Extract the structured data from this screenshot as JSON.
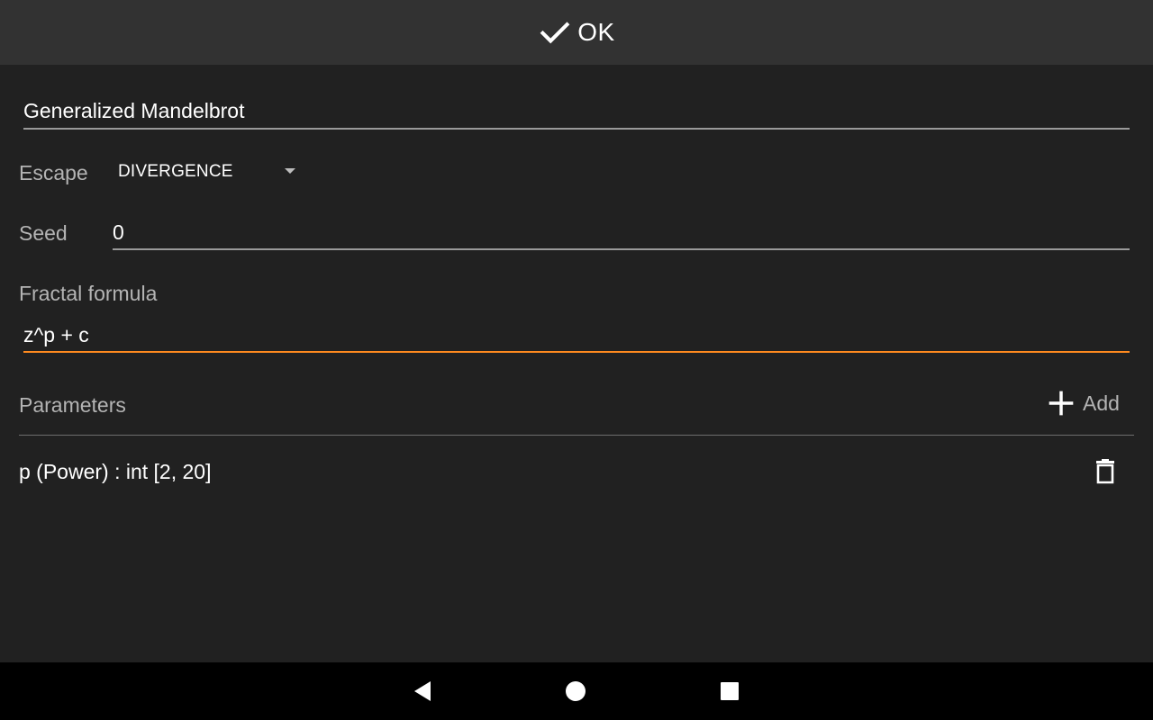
{
  "toolbar": {
    "ok_label": "OK",
    "ok_icon": "check-icon"
  },
  "form": {
    "name_value": "Generalized Mandelbrot",
    "escape_label": "Escape",
    "escape_value": "DIVERGENCE",
    "seed_label": "Seed",
    "seed_value": "0",
    "formula_label": "Fractal formula",
    "formula_value": "z^p + c"
  },
  "parameters": {
    "header_label": "Parameters",
    "add_label": "Add",
    "items": [
      {
        "text": "p (Power) : int [2, 20]"
      }
    ]
  },
  "colors": {
    "background": "#212121",
    "toolbar": "#323232",
    "focus_accent": "#ff8a1f",
    "navbar": "#000000"
  },
  "navbar": {
    "back_icon": "back-triangle-icon",
    "home_icon": "home-circle-icon",
    "recents_icon": "recents-square-icon"
  }
}
